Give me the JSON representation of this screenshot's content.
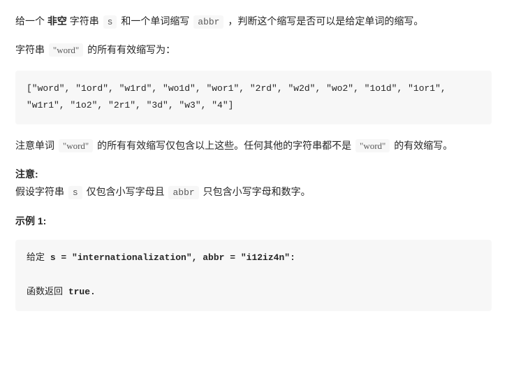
{
  "intro": {
    "t1": "给一个 ",
    "bold1": "非空",
    "t2": " 字符串 ",
    "code_s": "s",
    "t3": " 和一个单词缩写 ",
    "code_abbr": "abbr",
    "t4": " ，判断这个缩写是否可以是给定单词的缩写。"
  },
  "line2": {
    "t1": "字符串 ",
    "code_word": "\"word\"",
    "t2": " 的所有有效缩写为："
  },
  "abbr_list": "[\"word\", \"1ord\", \"w1rd\", \"wo1d\", \"wor1\", \"2rd\", \"w2d\", \"wo2\", \"1o1d\", \"1or1\", \"w1r1\", \"1o2\", \"2r1\", \"3d\", \"w3\", \"4\"]",
  "line3": {
    "t1": "注意单词 ",
    "code_word": "\"word\"",
    "t2": " 的所有有效缩写仅包含以上这些。任何其他的字符串都不是 ",
    "code_word2": "\"word\"",
    "t3": " 的有效缩写。"
  },
  "notice": {
    "label": "注意:",
    "t1": "假设字符串 ",
    "code_s": "s",
    "t2": " 仅包含小写字母且 ",
    "code_abbr": "abbr",
    "t3": " 只包含小写字母和数字。"
  },
  "example": {
    "label": "示例 1:",
    "given_pre": "给定 ",
    "given_bold": "s = \"internationalization\", abbr = \"i12iz4n\":",
    "return_pre": "函数返回 ",
    "return_bold": "true."
  }
}
